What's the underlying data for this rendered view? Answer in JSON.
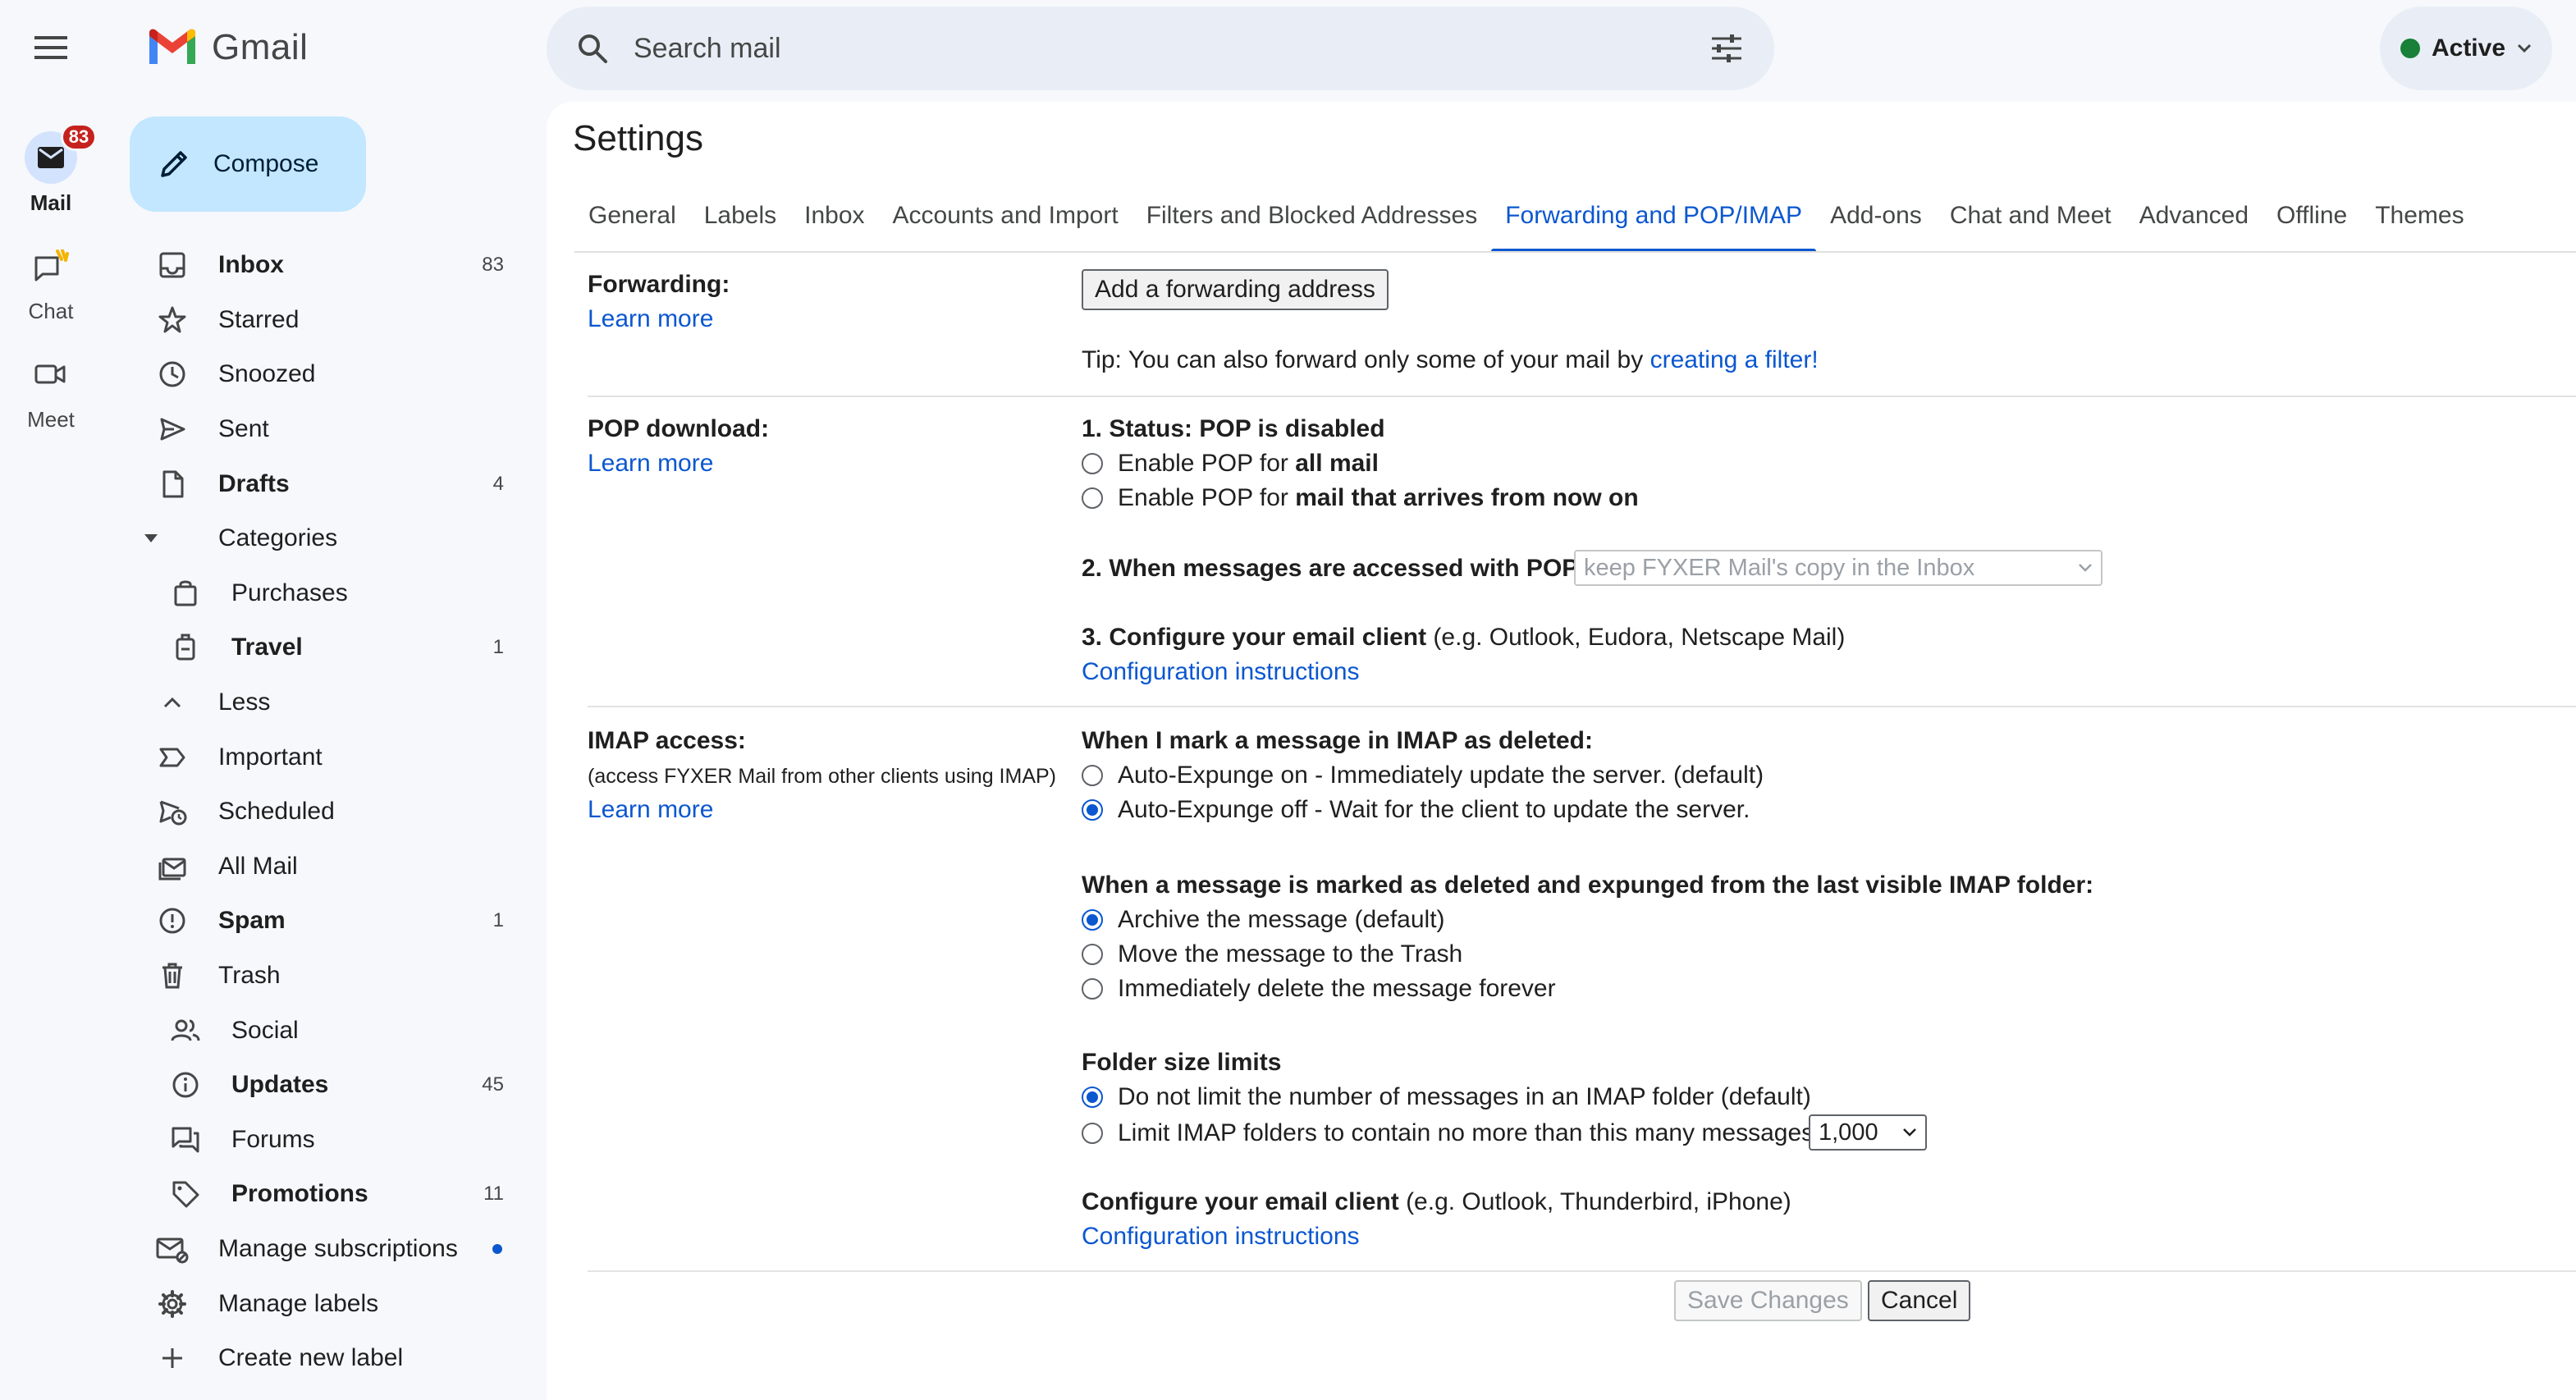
{
  "app": {
    "name": "Gmail"
  },
  "rail": {
    "items": [
      {
        "label": "Mail",
        "badge": "83"
      },
      {
        "label": "Chat"
      },
      {
        "label": "Meet"
      }
    ]
  },
  "search": {
    "placeholder": "Search mail"
  },
  "status": {
    "label": "Active",
    "color": "#188038"
  },
  "compose": {
    "label": "Compose"
  },
  "nav": {
    "items": [
      {
        "label": "Inbox",
        "count": "83",
        "icon": "inbox-icon"
      },
      {
        "label": "Starred",
        "icon": "star-icon"
      },
      {
        "label": "Snoozed",
        "icon": "clock-icon"
      },
      {
        "label": "Sent",
        "icon": "send-icon"
      },
      {
        "label": "Drafts",
        "count": "4",
        "icon": "draft-icon"
      },
      {
        "label": "Categories",
        "icon": "caret-down-icon"
      },
      {
        "label": "Purchases",
        "icon": "shopping-bag-icon"
      },
      {
        "label": "Travel",
        "count": "1",
        "icon": "luggage-icon"
      },
      {
        "label": "Less",
        "icon": "chevron-up-icon"
      },
      {
        "label": "Important",
        "icon": "label-important-icon"
      },
      {
        "label": "Scheduled",
        "icon": "scheduled-send-icon"
      },
      {
        "label": "All Mail",
        "icon": "all-mail-icon"
      },
      {
        "label": "Spam",
        "count": "1",
        "icon": "spam-icon"
      },
      {
        "label": "Trash",
        "icon": "trash-icon"
      },
      {
        "label": "Social",
        "icon": "people-icon"
      },
      {
        "label": "Updates",
        "count": "45",
        "icon": "info-icon"
      },
      {
        "label": "Forums",
        "icon": "forum-icon"
      },
      {
        "label": "Promotions",
        "count": "11",
        "icon": "tag-icon"
      },
      {
        "label": "Manage subscriptions",
        "icon": "subscriptions-icon"
      },
      {
        "label": "Manage labels",
        "icon": "gear-icon"
      },
      {
        "label": "Create new label",
        "icon": "plus-icon"
      }
    ]
  },
  "settings": {
    "title": "Settings",
    "tabs": [
      "General",
      "Labels",
      "Inbox",
      "Accounts and Import",
      "Filters and Blocked Addresses",
      "Forwarding and POP/IMAP",
      "Add-ons",
      "Chat and Meet",
      "Advanced",
      "Offline",
      "Themes"
    ],
    "active_tab": "Forwarding and POP/IMAP",
    "forwarding": {
      "title": "Forwarding:",
      "learn_more": "Learn more",
      "button": "Add a forwarding address",
      "tip_prefix": "Tip: You can also forward only some of your mail by ",
      "tip_link": "creating a filter!"
    },
    "pop": {
      "title": "POP download:",
      "learn_more": "Learn more",
      "status": "1. Status: POP is disabled",
      "opt1_prefix": "Enable POP for ",
      "opt1_bold": "all mail",
      "opt2_prefix": "Enable POP for ",
      "opt2_bold": "mail that arrives from now on",
      "access_label": "2. When messages are accessed with POP",
      "access_value": "keep FYXER Mail's copy in the Inbox",
      "configure_bold": "3. Configure your email client",
      "configure_rest": " (e.g. Outlook, Eudora, Netscape Mail)",
      "config_link": "Configuration instructions"
    },
    "imap": {
      "title": "IMAP access:",
      "subtitle": "(access FYXER Mail from other clients using IMAP)",
      "learn_more": "Learn more",
      "deleted_heading": "When I mark a message in IMAP as deleted:",
      "deleted_opt1": "Auto-Expunge on - Immediately update the server. (default)",
      "deleted_opt2": "Auto-Expunge off - Wait for the client to update the server.",
      "expunged_heading": "When a message is marked as deleted and expunged from the last visible IMAP folder:",
      "expunged_opt1": "Archive the message (default)",
      "expunged_opt2": "Move the message to the Trash",
      "expunged_opt3": "Immediately delete the message forever",
      "folder_heading": "Folder size limits",
      "folder_opt1": "Do not limit the number of messages in an IMAP folder (default)",
      "folder_opt2": "Limit IMAP folders to contain no more than this many messages",
      "folder_limit_value": "1,000",
      "configure_bold": "Configure your email client",
      "configure_rest": " (e.g. Outlook, Thunderbird, iPhone)",
      "config_link": "Configuration instructions"
    },
    "save_label": "Save Changes",
    "cancel_label": "Cancel"
  }
}
